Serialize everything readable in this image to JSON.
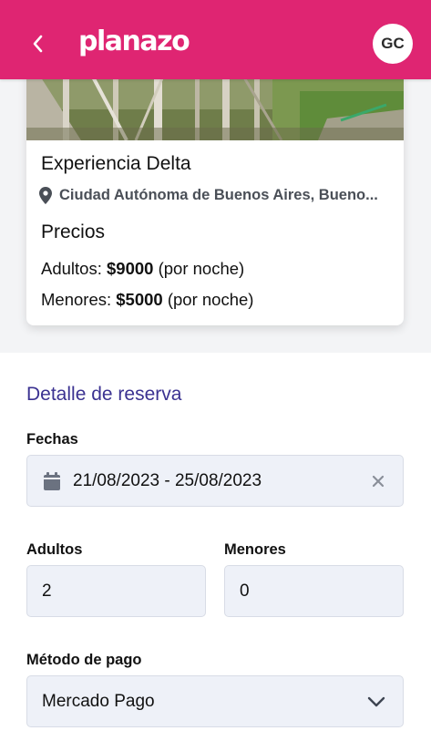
{
  "header": {
    "logo": "planazo",
    "avatar_initials": "GC",
    "brand_color": "#df2572"
  },
  "card": {
    "title": "Experiencia Delta",
    "location": "Ciudad Autónoma de Buenos Aires, Bueno...",
    "prices_title": "Precios",
    "adults_label": "Adultos:",
    "adults_price": "$9000",
    "adults_unit": "(por noche)",
    "minors_label": "Menores:",
    "minors_price": "$5000",
    "minors_unit": "(por noche)"
  },
  "form": {
    "section_title": "Detalle de reserva",
    "dates_label": "Fechas",
    "dates_value": "21/08/2023 - 25/08/2023",
    "adults_label": "Adultos",
    "adults_value": "2",
    "minors_label": "Menores",
    "minors_value": "0",
    "payment_label": "Método de pago",
    "payment_value": "Mercado Pago",
    "accent_color": "#3b3291"
  },
  "icons": [
    "chevron-left-icon",
    "location-pin-icon",
    "calendar-icon",
    "close-icon",
    "chevron-down-icon"
  ]
}
